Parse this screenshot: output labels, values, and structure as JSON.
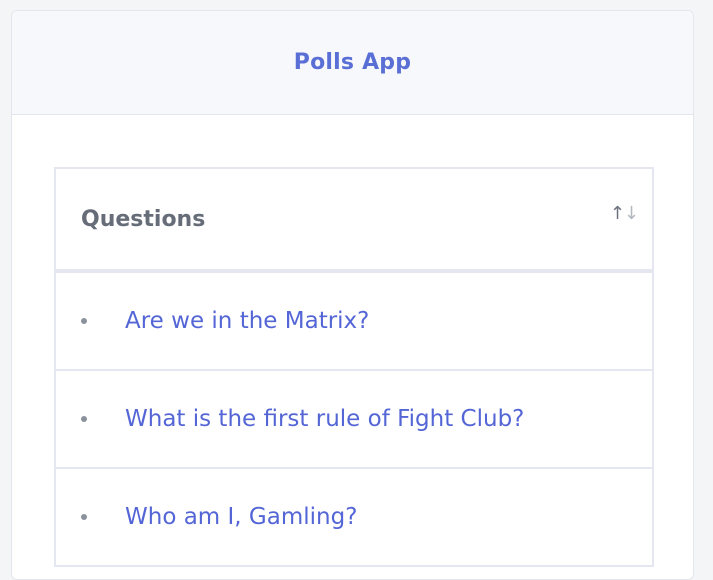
{
  "header": {
    "title": "Polls App"
  },
  "table": {
    "heading": "Questions",
    "sort_icon": "sort-arrows-icon",
    "rows": [
      {
        "label": "Are we in the Matrix?"
      },
      {
        "label": "What is the first rule of Fight Club?"
      },
      {
        "label": "Who am I, Gamling?"
      }
    ]
  },
  "colors": {
    "accent": "#5466d6",
    "header_bg": "#f7f8fc",
    "border": "#e4e7f0"
  }
}
